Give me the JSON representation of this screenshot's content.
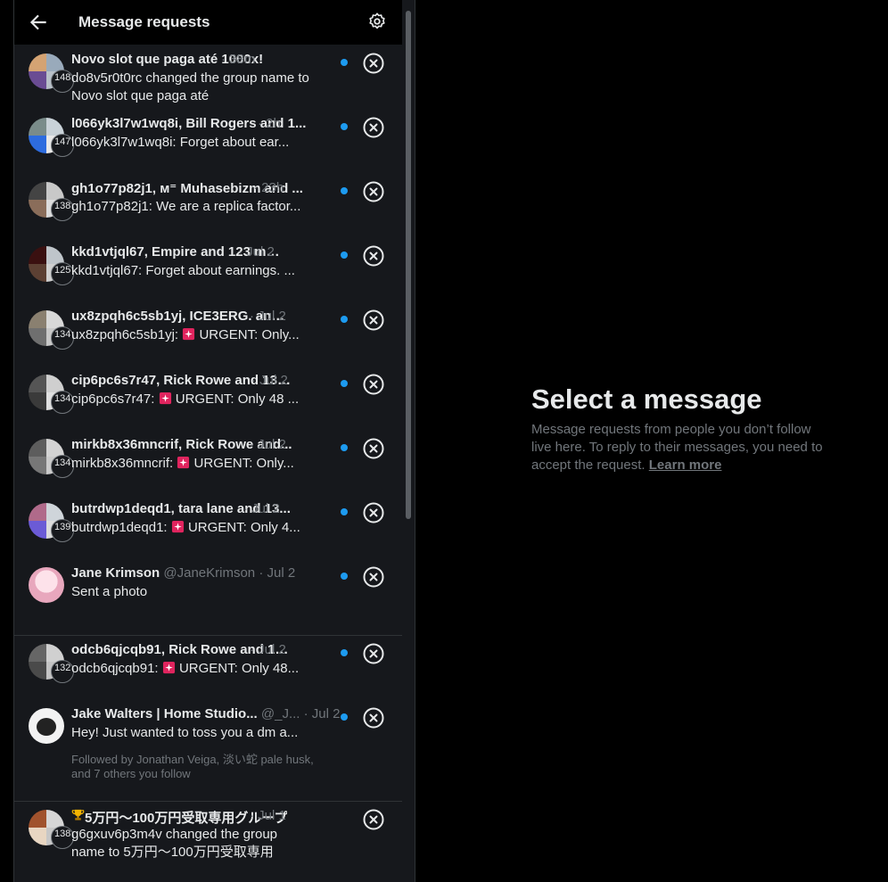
{
  "header": {
    "title": "Message requests",
    "back_icon": "arrow-left-icon",
    "settings_icon": "gear-icon"
  },
  "requests": [
    {
      "name": "Novo slot que paga até 1000x!",
      "handle": "",
      "time": "· 38m",
      "count": "148",
      "message": "do8v5r0t0rc changed the group name to Novo slot que paga até",
      "unread": true
    },
    {
      "name": "l066yk3l7w1wq8i, Bill Rogers and 1...",
      "handle": "",
      "time": "· 2h",
      "count": "147",
      "message": "l066yk3l7w1wq8i: Forget about ear...",
      "unread": true
    },
    {
      "name": "gh1o77p82j1, ᴍ⁼ Muhasebizm and ...",
      "handle": "",
      "time": "· 23h",
      "count": "138",
      "message": "gh1o77p82j1: We are a replica factor...",
      "unread": true
    },
    {
      "name": "kkd1vtjql67, Empire and 123 more",
      "handle": "",
      "time": "· Jul 2",
      "count": "125",
      "message": "kkd1vtjql67: Forget about earnings. ...",
      "unread": true
    },
    {
      "name": "ux8zpqh6c5sb1yj, ICE3ERG. and ...",
      "handle": "",
      "time": "· Jul 2",
      "count": "134",
      "message_prefix": "ux8zpqh6c5sb1yj:",
      "message": "URGENT: Only...",
      "unread": true
    },
    {
      "name": "cip6pc6s7r47, Rick Rowe and 132 ...",
      "handle": "",
      "time": "· Jul 2",
      "count": "134",
      "message_prefix": "cip6pc6s7r47:",
      "message": "URGENT: Only 48 ...",
      "unread": true
    },
    {
      "name": "mirkb8x36mncrif, Rick Rowe and...",
      "handle": "",
      "time": "· Jul 2",
      "count": "134",
      "message_prefix": "mirkb8x36mncrif:",
      "message": "URGENT: Only...",
      "unread": true
    },
    {
      "name": "butrdwp1deqd1, tara lane and 13...",
      "handle": "",
      "time": "· Jul 2",
      "count": "139",
      "message_prefix": "butrdwp1deqd1:",
      "message": "URGENT: Only 4...",
      "unread": true
    },
    {
      "name": "Jane Krimson",
      "handle": "@JaneKrimson",
      "time": "· Jul 2",
      "count": "",
      "message": "Sent a photo",
      "unread": true
    },
    {
      "name": "odcb6qjcqb91, Rick Rowe and 13...",
      "handle": "",
      "time": "· Jul 2",
      "count": "132",
      "message_prefix": "odcb6qjcqb91:",
      "message": "URGENT: Only 48...",
      "unread": true
    },
    {
      "name": "Jake Walters | Home Studio...",
      "handle": "@_J...",
      "time": "· Jul 2",
      "count": "",
      "message": "Hey! Just wanted to toss you a dm a...",
      "unread": true,
      "followed_by": "Followed by Jonathan Veiga, 淡い蛇 pale husk, and 7 others you follow"
    },
    {
      "name": "5万円〜100万円受取専用グループ",
      "handle": "",
      "time": "· Jul 1",
      "count": "138",
      "message": "g6gxuv6p3m4v changed the group name to 5万円〜100万円受取専用",
      "unread": false
    }
  ],
  "empty_state": {
    "title": "Select a message",
    "description": "Message requests from people you don’t follow live here. To reply to their messages, you need to accept the request.",
    "link": "Learn more"
  },
  "icons": {
    "dismiss": "close-circle-icon",
    "unread": "unread-dot-icon",
    "siren": "siren-emoji-icon",
    "trophy": "trophy-emoji-icon"
  },
  "colors": {
    "accent": "#1d9bf0",
    "background": "#000000",
    "panel": "#16181c",
    "muted": "#71767b"
  }
}
